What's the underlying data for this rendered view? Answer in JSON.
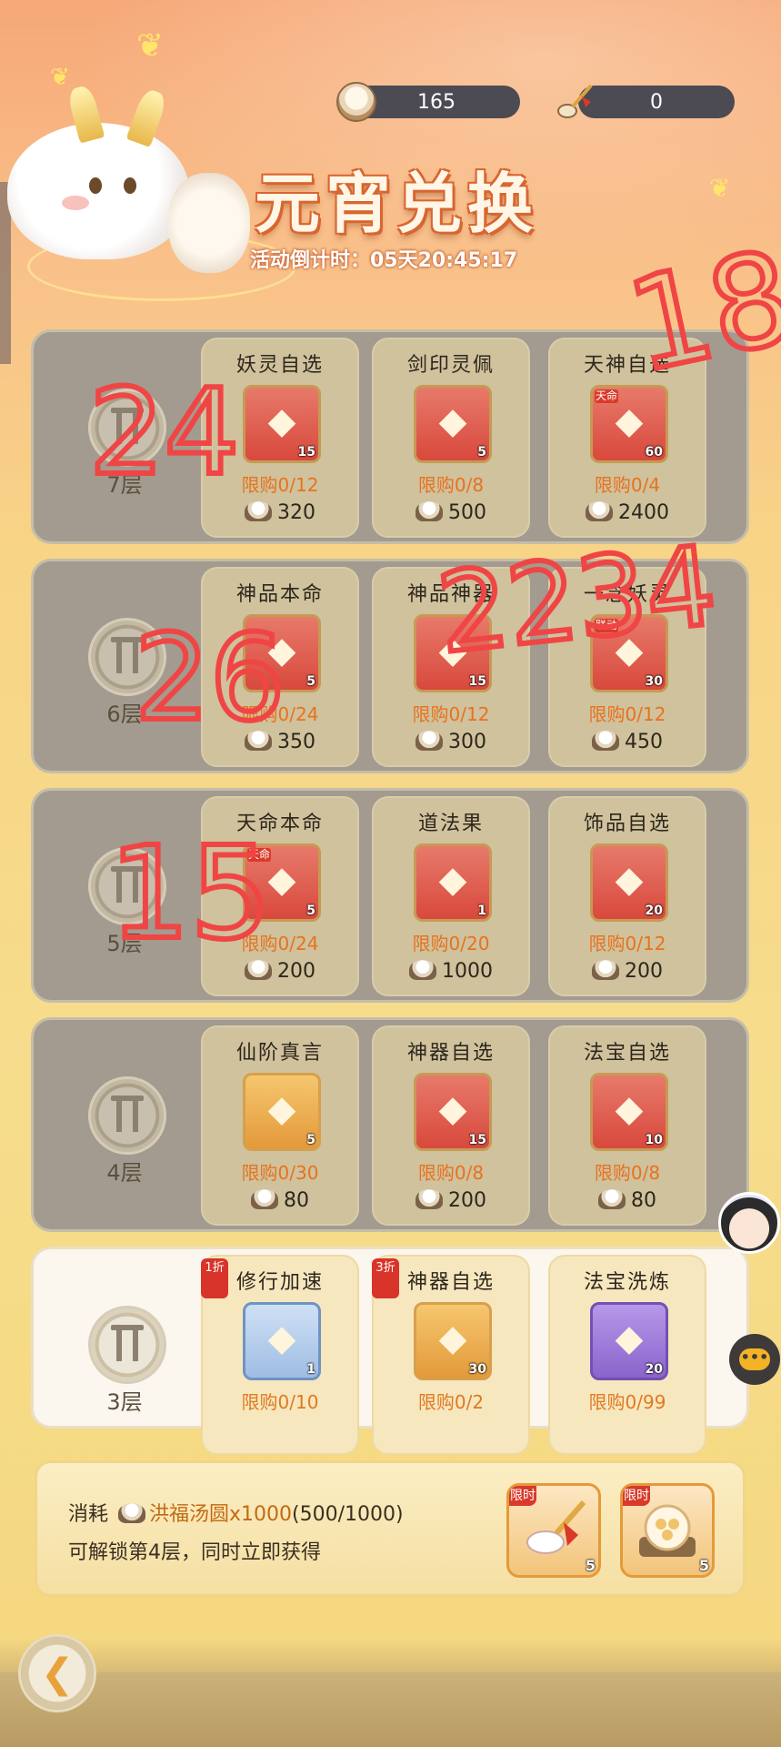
{
  "header": {
    "title": "元宵兑换",
    "countdown": "活动倒计时：05天20:45:17",
    "currency_tangyuan": "165",
    "currency_spoon": "0"
  },
  "floors": [
    {
      "label": "7层",
      "items": [
        {
          "name": "妖灵自选",
          "qty": "15",
          "limit": "限购0/12",
          "price": "320"
        },
        {
          "name": "剑印灵佩",
          "qty": "5",
          "limit": "限购0/8",
          "price": "500"
        },
        {
          "name": "天神自选",
          "qty": "60",
          "limit": "限购0/4",
          "price": "2400",
          "tag": "天命"
        }
      ]
    },
    {
      "label": "6层",
      "items": [
        {
          "name": "神品本命",
          "qty": "5",
          "limit": "限购0/24",
          "price": "350"
        },
        {
          "name": "神品神器",
          "qty": "15",
          "limit": "限购0/12",
          "price": "300"
        },
        {
          "name": "一念妖灵",
          "qty": "30",
          "limit": "限购0/12",
          "price": "450",
          "tag": "联动"
        }
      ]
    },
    {
      "label": "5层",
      "items": [
        {
          "name": "天命本命",
          "qty": "5",
          "limit": "限购0/24",
          "price": "200",
          "tag": "天命"
        },
        {
          "name": "道法果",
          "qty": "1",
          "limit": "限购0/20",
          "price": "1000"
        },
        {
          "name": "饰品自选",
          "qty": "20",
          "limit": "限购0/12",
          "price": "200"
        }
      ]
    },
    {
      "label": "4层",
      "items": [
        {
          "name": "仙阶真言",
          "qty": "5",
          "limit": "限购0/30",
          "price": "80"
        },
        {
          "name": "神器自选",
          "qty": "15",
          "limit": "限购0/8",
          "price": "200"
        },
        {
          "name": "法宝自选",
          "qty": "10",
          "limit": "限购0/8",
          "price": "80"
        }
      ]
    },
    {
      "label": "3层",
      "items": [
        {
          "name": "修行加速",
          "qty": "1",
          "limit": "限购0/10",
          "discount": "1折"
        },
        {
          "name": "神器自选",
          "qty": "30",
          "limit": "限购0/2",
          "discount": "3折"
        },
        {
          "name": "法宝洗炼",
          "qty": "20",
          "limit": "限购0/99"
        }
      ]
    }
  ],
  "unlock": {
    "prefix": "消耗",
    "currency_name": "洪福汤圆",
    "amount": "x1000",
    "progress": "(500/1000)",
    "line2": "可解锁第4层，同时立即获得",
    "rewards": [
      {
        "tag": "限时",
        "qty": "5"
      },
      {
        "tag": "限时",
        "qty": "5"
      }
    ]
  },
  "handwriting": [
    "18",
    "24",
    "2234",
    "26",
    "15"
  ]
}
